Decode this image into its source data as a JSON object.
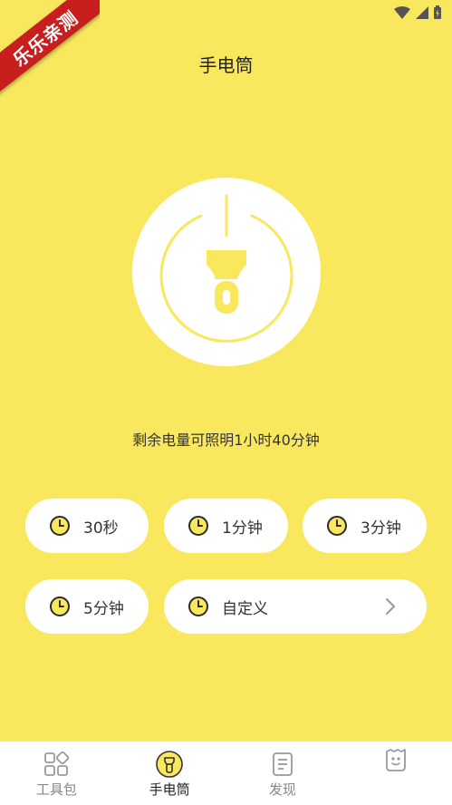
{
  "ribbon": {
    "text": "乐乐亲测"
  },
  "header": {
    "title": "手电筒"
  },
  "status": {
    "text": "剩余电量可照明1小时40分钟"
  },
  "timers": [
    {
      "label": "30秒"
    },
    {
      "label": "1分钟"
    },
    {
      "label": "3分钟"
    },
    {
      "label": "5分钟"
    },
    {
      "label": "自定义"
    }
  ],
  "tabs": [
    {
      "label": "工具包",
      "icon": "toolbox-icon"
    },
    {
      "label": "手电筒",
      "icon": "flashlight-icon",
      "active": true
    },
    {
      "label": "发现",
      "icon": "document-icon"
    },
    {
      "label": "",
      "icon": "profile-icon"
    }
  ],
  "colors": {
    "background": "#F9E85E",
    "accent": "#F9E85E",
    "clock": "#2B2B2B",
    "ribbon": "#C81E1E"
  }
}
